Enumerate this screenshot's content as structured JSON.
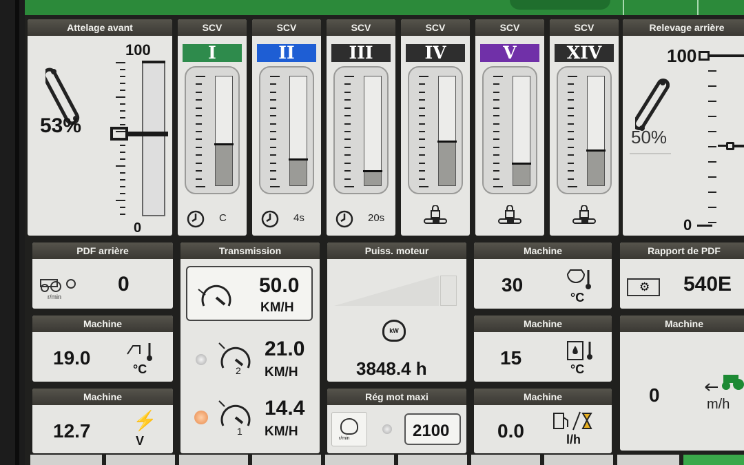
{
  "atf": {
    "title": "Attelage avant",
    "max": "100",
    "min": "0",
    "percent": "53%",
    "level": 0.53
  },
  "scv": [
    {
      "head": "SCV",
      "label": "I",
      "color": "#2e8b4c",
      "level": 0.37,
      "timer": "C",
      "mode": "timer"
    },
    {
      "head": "SCV",
      "label": "II",
      "color": "#1e5ed4",
      "level": 0.23,
      "timer": "4s",
      "mode": "timer"
    },
    {
      "head": "SCV",
      "label": "III",
      "color": "#2e2e2e",
      "level": 0.12,
      "timer": "20s",
      "mode": "timer"
    },
    {
      "head": "SCV",
      "label": "IV",
      "color": "#2e2e2e",
      "level": 0.39,
      "timer": "",
      "mode": "lock"
    },
    {
      "head": "SCV",
      "label": "V",
      "color": "#7030a8",
      "level": 0.19,
      "timer": "",
      "mode": "lock"
    },
    {
      "head": "SCV",
      "label": "XIV",
      "color": "#2e2e2e",
      "level": 0.31,
      "timer": "",
      "mode": "lock"
    }
  ],
  "rear_hitch": {
    "title": "Relevage arrière",
    "max": "100",
    "min": "0",
    "percent": "50%",
    "level": 0.5
  },
  "pto_rear": {
    "title": "PDF arrière",
    "value": "0",
    "unit": "r/min"
  },
  "transmission": {
    "title": "Transmission",
    "current_speed": "50.0",
    "current_unit": "KM/H",
    "gear2_speed": "21.0",
    "gear2_unit": "KM/H",
    "gear2_num": "2",
    "gear1_speed": "14.4",
    "gear1_unit": "KM/H",
    "gear1_num": "1"
  },
  "engine_power": {
    "title": "Puiss. moteur",
    "hours": "3848.4 h",
    "icon": "kW"
  },
  "machine_temp1": {
    "title": "Machine",
    "value": "30",
    "unit": "°C"
  },
  "pto_ratio": {
    "title": "Rapport de PDF",
    "value": "540E"
  },
  "machine_temp2": {
    "title": "Machine",
    "value": "19.0",
    "unit": "°C"
  },
  "machine_temp3": {
    "title": "Machine",
    "value": "15",
    "unit": "°C"
  },
  "machine_speed": {
    "title": "Machine",
    "value": "0",
    "unit": "m/h"
  },
  "machine_volt": {
    "title": "Machine",
    "value": "12.7",
    "unit": "V"
  },
  "reg_mot": {
    "title": "Rég mot maxi",
    "value": "2100",
    "unit": "r/min"
  },
  "machine_fuel": {
    "title": "Machine",
    "value": "0.0",
    "unit": "l/h"
  }
}
